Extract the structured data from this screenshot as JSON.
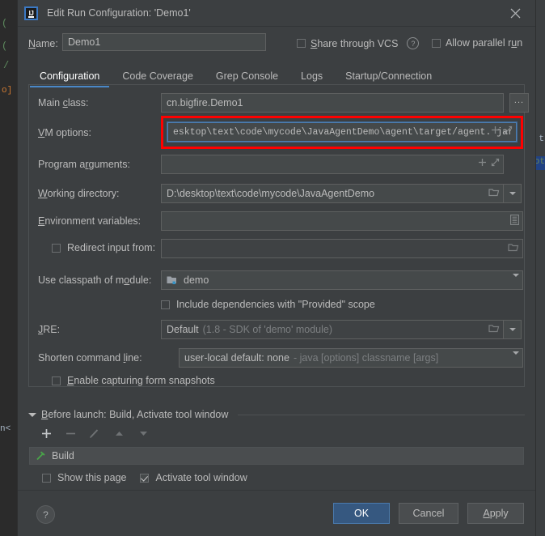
{
  "background": {
    "left_token_1": "o]",
    "left_token_2": "n<",
    "left_glyph_1": "(",
    "left_glyph_2": "(",
    "left_glyph_3": "/",
    "right_token": "ot",
    "right_token_2": "t"
  },
  "titlebar": {
    "app_icon": "intellij-idea-logo",
    "logo_text": "IJ",
    "title": "Edit Run Configuration: 'Demo1'",
    "close_icon": "close-icon"
  },
  "name_row": {
    "label": "Name:",
    "label_mnemonic": "N",
    "value": "Demo1",
    "share_vcs_label": "Share through VCS",
    "share_vcs_mnemonic": "S",
    "share_vcs_checked": false,
    "help_icon": "question-mark-icon",
    "allow_parallel_label": "Allow parallel run",
    "allow_parallel_mnemonic": "u",
    "allow_parallel_checked": false
  },
  "tabs": [
    {
      "label": "Configuration",
      "active": true
    },
    {
      "label": "Code Coverage",
      "active": false
    },
    {
      "label": "Grep Console",
      "active": false
    },
    {
      "label": "Logs",
      "active": false
    },
    {
      "label": "Startup/Connection",
      "active": false
    }
  ],
  "form": {
    "main_class": {
      "label": "Main class:",
      "value": "cn.bigfire.Demo1",
      "browse_button": "...",
      "browse_icon": "ellipsis-icon"
    },
    "vm_options": {
      "label": "VM options:",
      "value": "esktop\\text\\code\\mycode\\JavaAgentDemo\\agent\\target/agent. jar=input",
      "expand_icon": "expand-icon",
      "insert_icon": "plus-macro-icon",
      "highlighted": true,
      "highlight_color": "#fe0000"
    },
    "program_arguments": {
      "label": "Program arguments:",
      "value": "",
      "insert_icon": "plus-macro-icon",
      "expand_icon": "expand-icon"
    },
    "working_directory": {
      "label": "Working directory:",
      "value": "D:\\desktop\\text\\code\\mycode\\JavaAgentDemo",
      "browse_icon": "folder-icon",
      "dropdown_icon": "chevron-down-icon"
    },
    "environment_variables": {
      "label": "Environment variables:",
      "value": "",
      "editor_icon": "list-edit-icon"
    },
    "redirect_input": {
      "label": "Redirect input from:",
      "checked": false,
      "value": "",
      "browse_icon": "folder-icon"
    },
    "classpath_module": {
      "label": "Use classpath of module:",
      "value": "demo",
      "module_icon": "module-folder-icon",
      "dropdown_icon": "chevron-down-icon"
    },
    "include_provided": {
      "label": "Include dependencies with \"Provided\" scope",
      "checked": false
    },
    "jre": {
      "label": "JRE:",
      "value": "Default",
      "hint": "(1.8 - SDK of 'demo' module)",
      "browse_icon": "folder-icon",
      "dropdown_icon": "chevron-down-icon"
    },
    "shorten_command_line": {
      "label": "Shorten command line:",
      "value": "user-local default: none",
      "hint": "- java [options] classname [args]",
      "dropdown_icon": "chevron-down-icon"
    },
    "form_snapshots": {
      "label": "Enable capturing form snapshots",
      "checked": false
    }
  },
  "before_launch": {
    "header": "Before launch: Build, Activate tool window",
    "collapse_icon": "triangle-down-icon",
    "toolbar": [
      {
        "name": "add-button",
        "glyph": "+",
        "enabled": true
      },
      {
        "name": "remove-button",
        "glyph": "−",
        "enabled": false
      },
      {
        "name": "edit-button",
        "glyph": "pencil-icon",
        "enabled": false
      },
      {
        "name": "move-up-button",
        "glyph": "triangle-up-icon",
        "enabled": false
      },
      {
        "name": "move-down-button",
        "glyph": "triangle-down-icon",
        "enabled": false
      }
    ],
    "items": [
      {
        "label": "Build",
        "icon": "hammer-icon",
        "icon_color": "#49a549"
      }
    ],
    "show_this_page": {
      "label": "Show this page",
      "checked": false
    },
    "activate_tool_window": {
      "label": "Activate tool window",
      "checked": true
    }
  },
  "footer": {
    "help_icon": "question-mark-icon",
    "ok_label": "OK",
    "cancel_label": "Cancel",
    "apply_label": "Apply",
    "apply_mnemonic": "A",
    "accent_color": "#365880"
  }
}
